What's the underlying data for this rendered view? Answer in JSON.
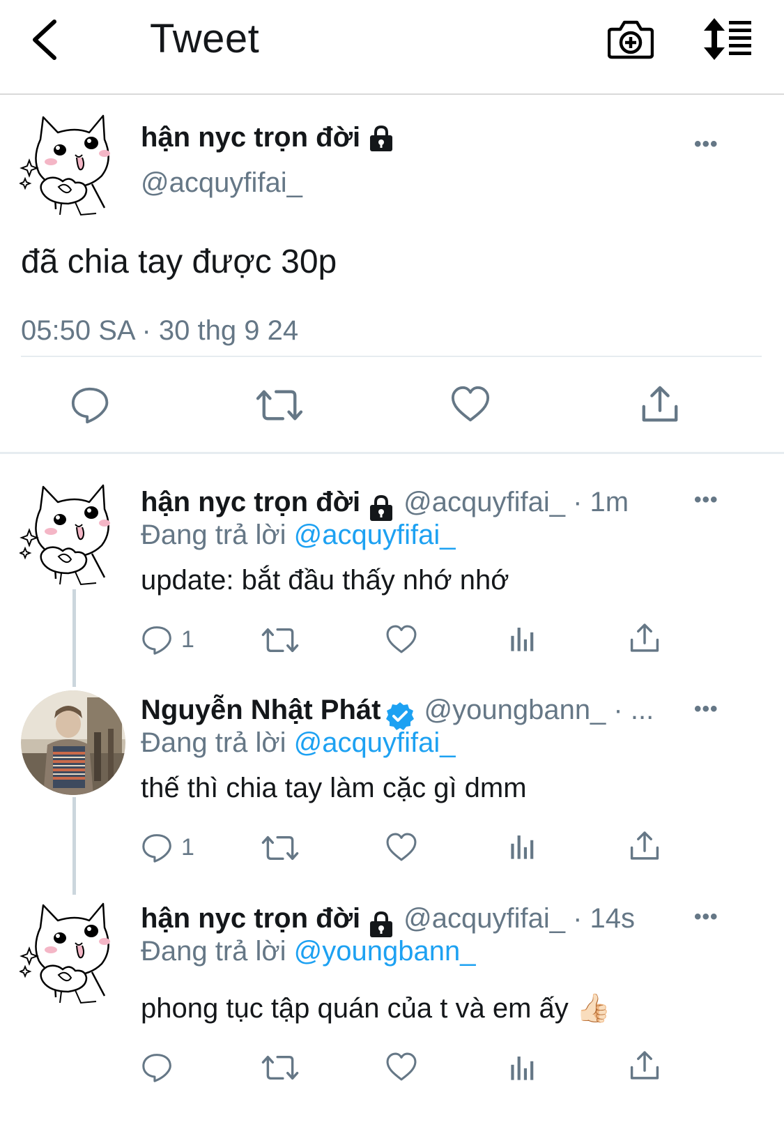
{
  "header": {
    "title": "Tweet"
  },
  "main_tweet": {
    "name": "hận nyc trọn đời",
    "handle": "@acquyfifai_",
    "text": "đã chia tay được 30p",
    "timestamp": "05:50 SA · 30 thg 9 24",
    "more": "•••"
  },
  "replies": [
    {
      "name": "hận nyc trọn đời",
      "handle_time": "@acquyfifai_ · 1m",
      "replying_label": "Đang trả lời",
      "replying_to": "@acquyfifai_",
      "text": "update: bắt đầu thấy nhớ nhớ",
      "reply_count": "1",
      "more": "•••"
    },
    {
      "name": "Nguyễn Nhật Phát",
      "handle_time": "@youngbann_ · ...",
      "replying_label": "Đang trả lời",
      "replying_to": "@acquyfifai_",
      "text": "thế thì chia tay làm cặc gì dmm",
      "reply_count": "1",
      "more": "•••"
    },
    {
      "name": "hận nyc trọn đời",
      "handle_time": "@acquyfifai_ · 14s",
      "replying_label": "Đang trả lời",
      "replying_to": "@youngbann_",
      "text": "phong tục tập quán của t và em ấy 👍🏻",
      "reply_count": "",
      "more": "•••"
    }
  ],
  "icons": [
    "back-arrow-icon",
    "camera-plus-icon",
    "sort-icon",
    "lock-icon",
    "verified-icon",
    "reply-icon",
    "retweet-icon",
    "like-icon",
    "analytics-icon",
    "share-icon",
    "more-icon"
  ],
  "colors": {
    "text": "#14171a",
    "secondary": "#657786",
    "link": "#1da1f2",
    "divider": "#e6ecf0"
  }
}
